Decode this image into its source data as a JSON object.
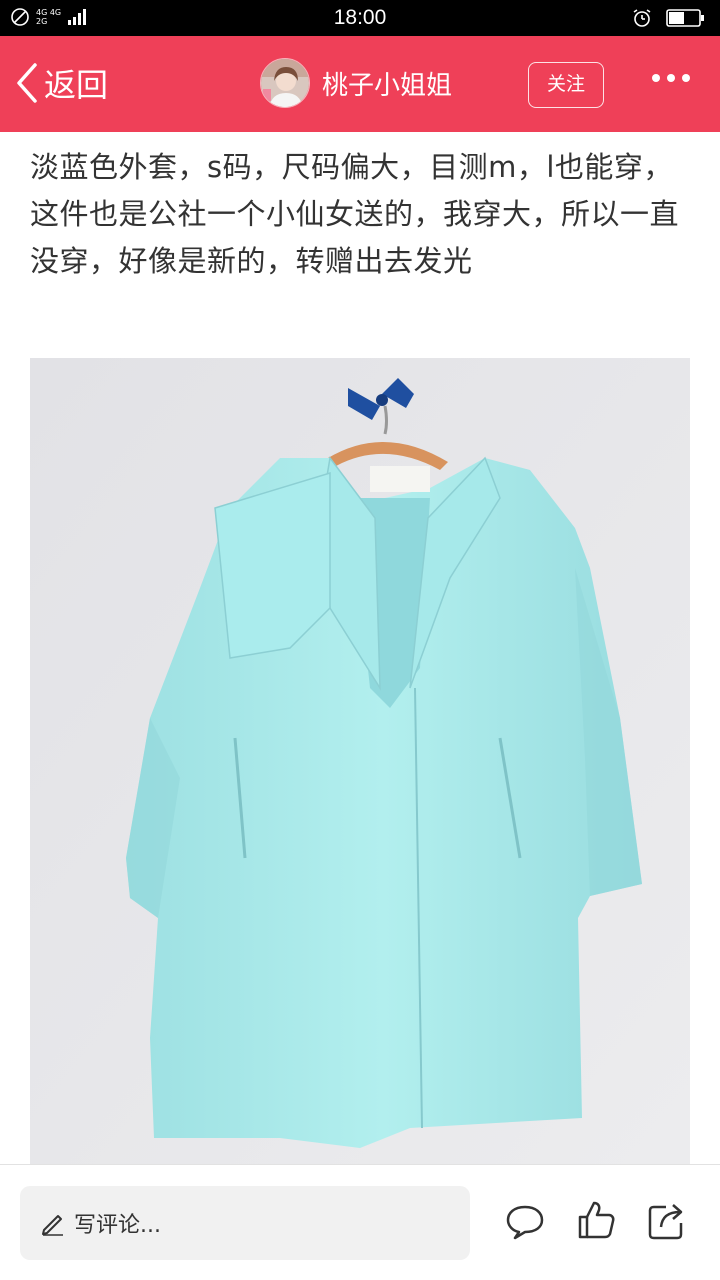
{
  "status_bar": {
    "network_top": "4G 4G",
    "network_bottom": "2G",
    "time": "18:00"
  },
  "header": {
    "back_label": "返回",
    "username": "桃子小姐姐",
    "follow_label": "关注"
  },
  "post": {
    "text": "淡蓝色外套，s码，尺码偏大，目测m，l也能穿，这件也是公社一个小仙女送的，我穿大，所以一直没穿，好像是新的，转赠出去发光"
  },
  "bottom_bar": {
    "comment_placeholder": "写评论..."
  },
  "colors": {
    "header_bg": "#ef4058",
    "coat": "#a9eaea",
    "wall": "#e6e6e8"
  },
  "icons": [
    "signal-icon",
    "alarm-icon",
    "battery-icon",
    "back-chevron-icon",
    "more-dots-icon",
    "pen-icon",
    "comment-bubble-icon",
    "thumbs-up-icon",
    "share-icon"
  ]
}
